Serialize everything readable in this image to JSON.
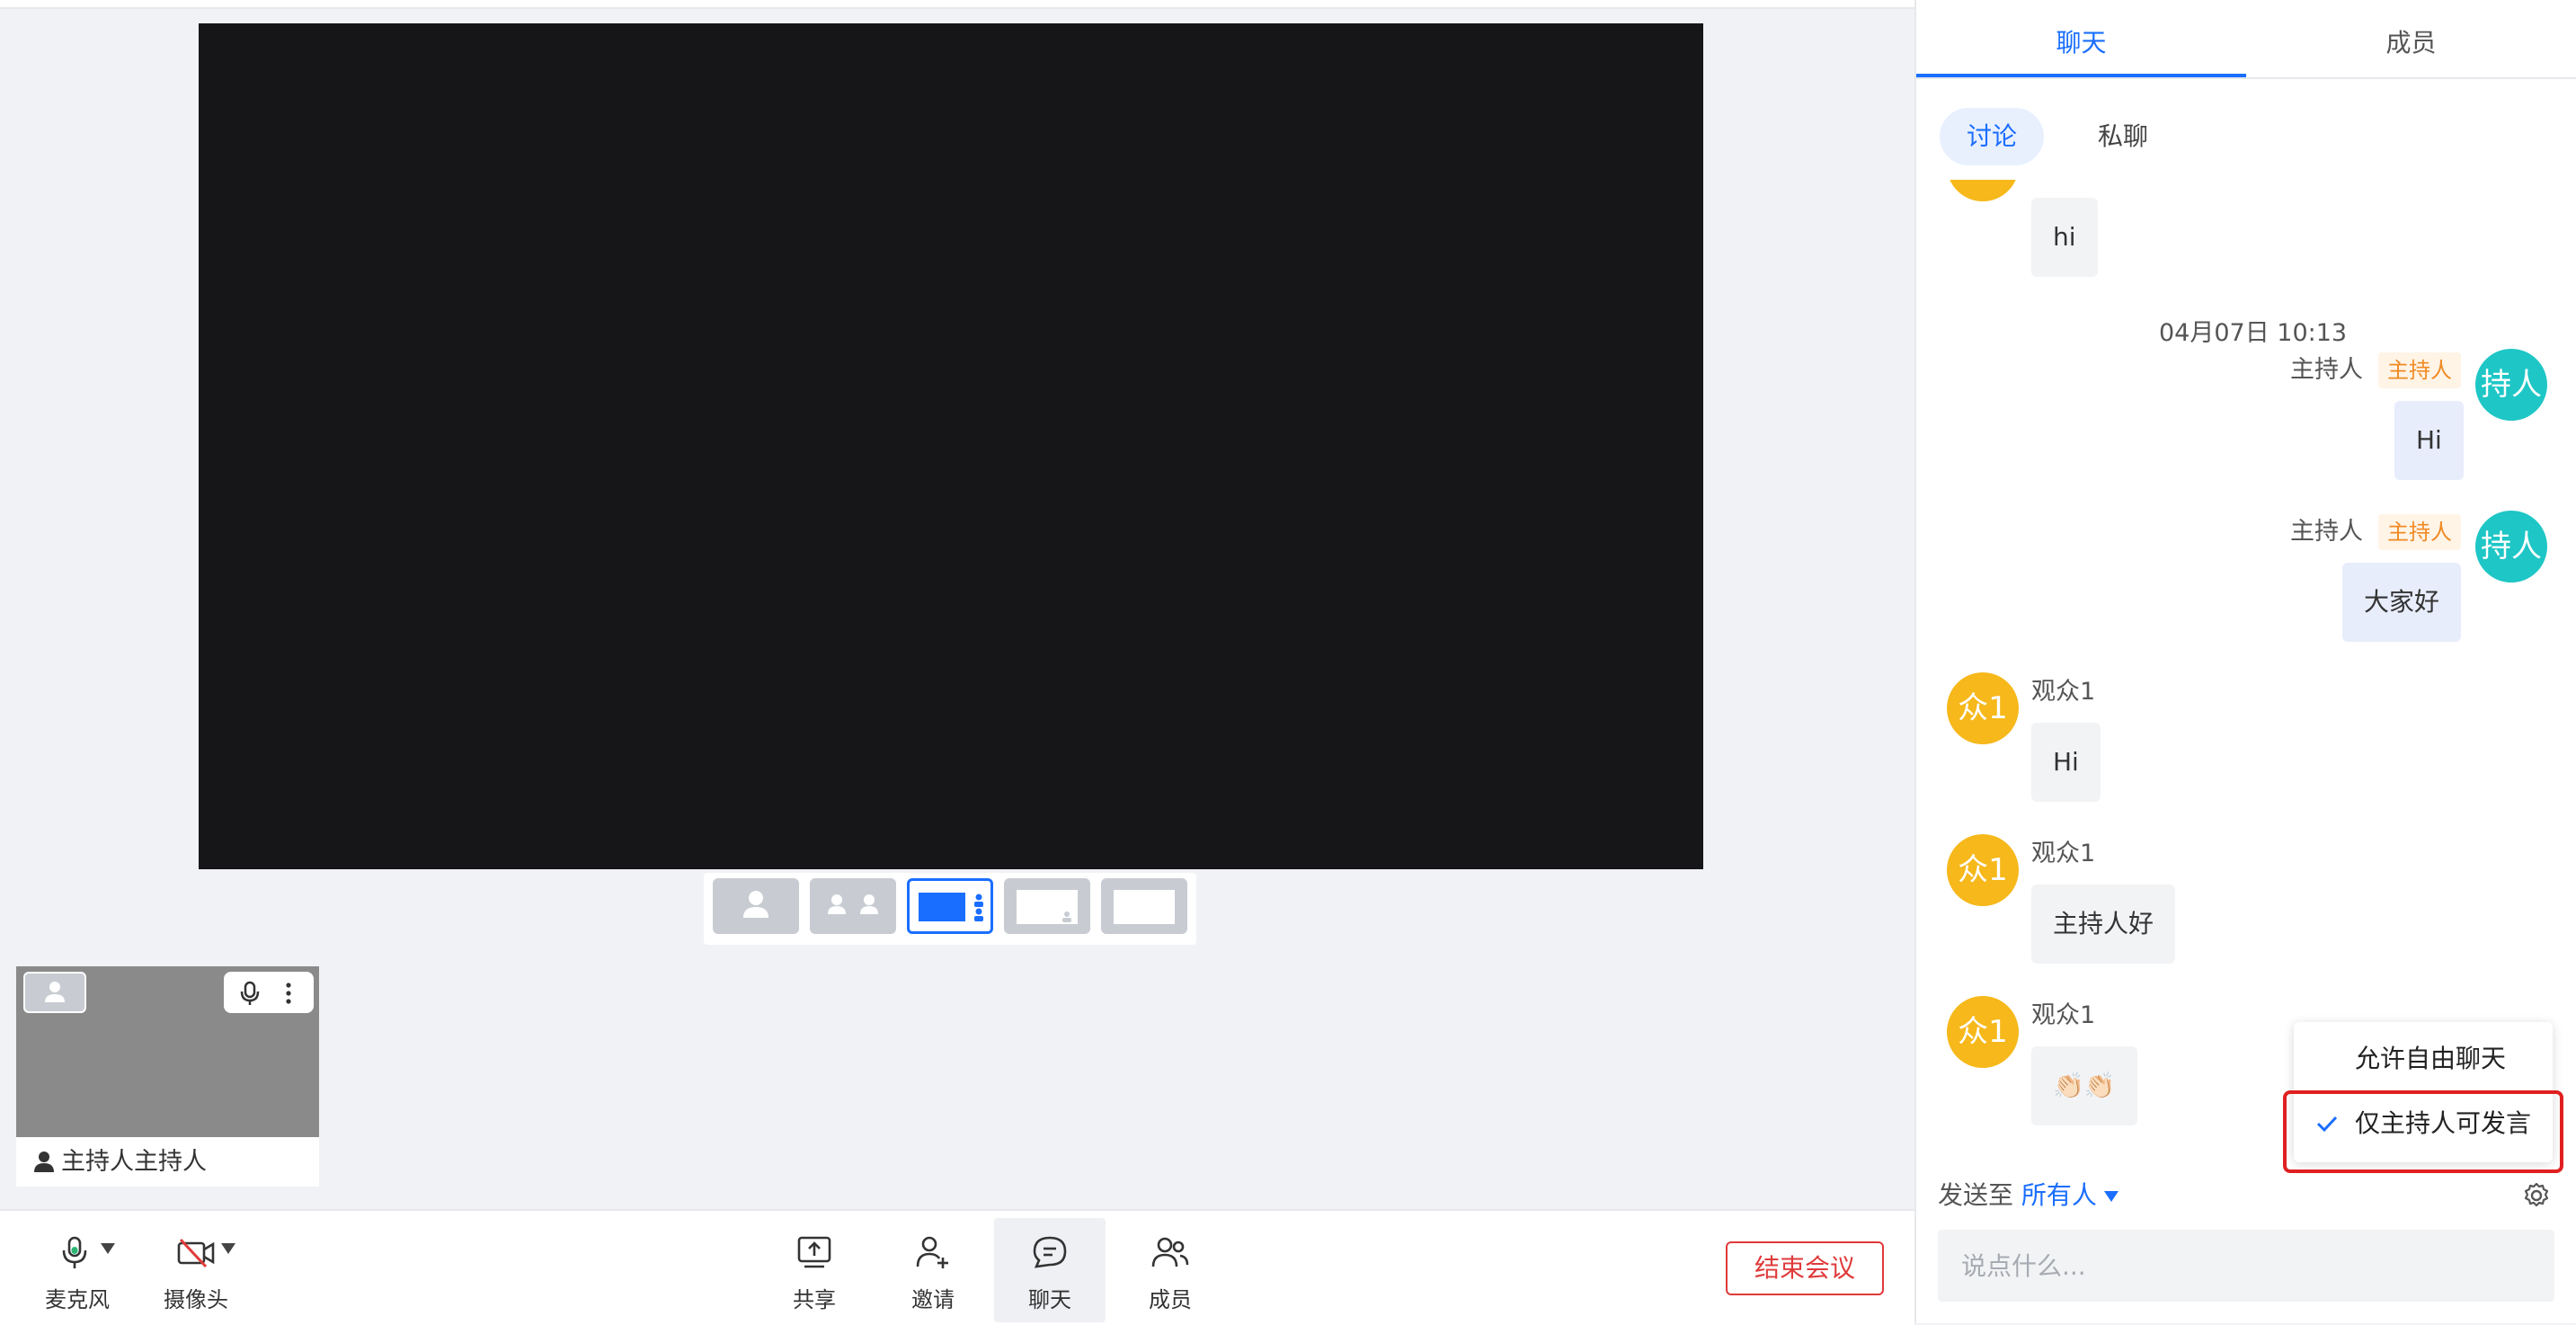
{
  "colors": {
    "accent": "#1a6eff",
    "danger": "#e03a3a",
    "audience_avatar": "#f6b81a",
    "host_avatar": "#1ec6c6",
    "host_badge": "#f08a24"
  },
  "local_video": {
    "name": "主持人主持人",
    "icons": [
      "mic-icon",
      "more-vertical-icon",
      "person-icon"
    ]
  },
  "layout_options": [
    "single-speaker",
    "two-grid",
    "speaker-with-sidebar",
    "picture-in-picture",
    "full-screen"
  ],
  "toolbar": {
    "mic_label": "麦克风",
    "camera_label": "摄像头",
    "share_label": "共享",
    "invite_label": "邀请",
    "chat_label": "聊天",
    "members_label": "成员",
    "end_label": "结束会议"
  },
  "panel": {
    "tabs": [
      {
        "label": "聊天"
      },
      {
        "label": "成员"
      }
    ],
    "subtabs": [
      {
        "label": "讨论"
      },
      {
        "label": "私聊"
      }
    ]
  },
  "messages": {
    "first_bubble": "hi",
    "timestamp": "04月07日 10:13",
    "host_msgs": [
      {
        "sender": "主持人",
        "badge": "主持人",
        "avatar": "持人",
        "text": "Hi"
      },
      {
        "sender": "主持人",
        "badge": "主持人",
        "avatar": "持人",
        "text": "大家好"
      }
    ],
    "audience_msgs": [
      {
        "sender": "观众1",
        "avatar": "众1",
        "text": "Hi"
      },
      {
        "sender": "观众1",
        "avatar": "众1",
        "text": "主持人好"
      },
      {
        "sender": "观众1",
        "avatar": "众1",
        "text": "👏🏻👏🏻"
      }
    ]
  },
  "chat_permission_menu": {
    "options": [
      {
        "label": "允许自由聊天"
      },
      {
        "label": "仅主持人可发言"
      }
    ],
    "selected": "仅主持人可发言"
  },
  "composer": {
    "send_to_label": "发送至",
    "send_to_target": "所有人",
    "placeholder": "说点什么..."
  }
}
